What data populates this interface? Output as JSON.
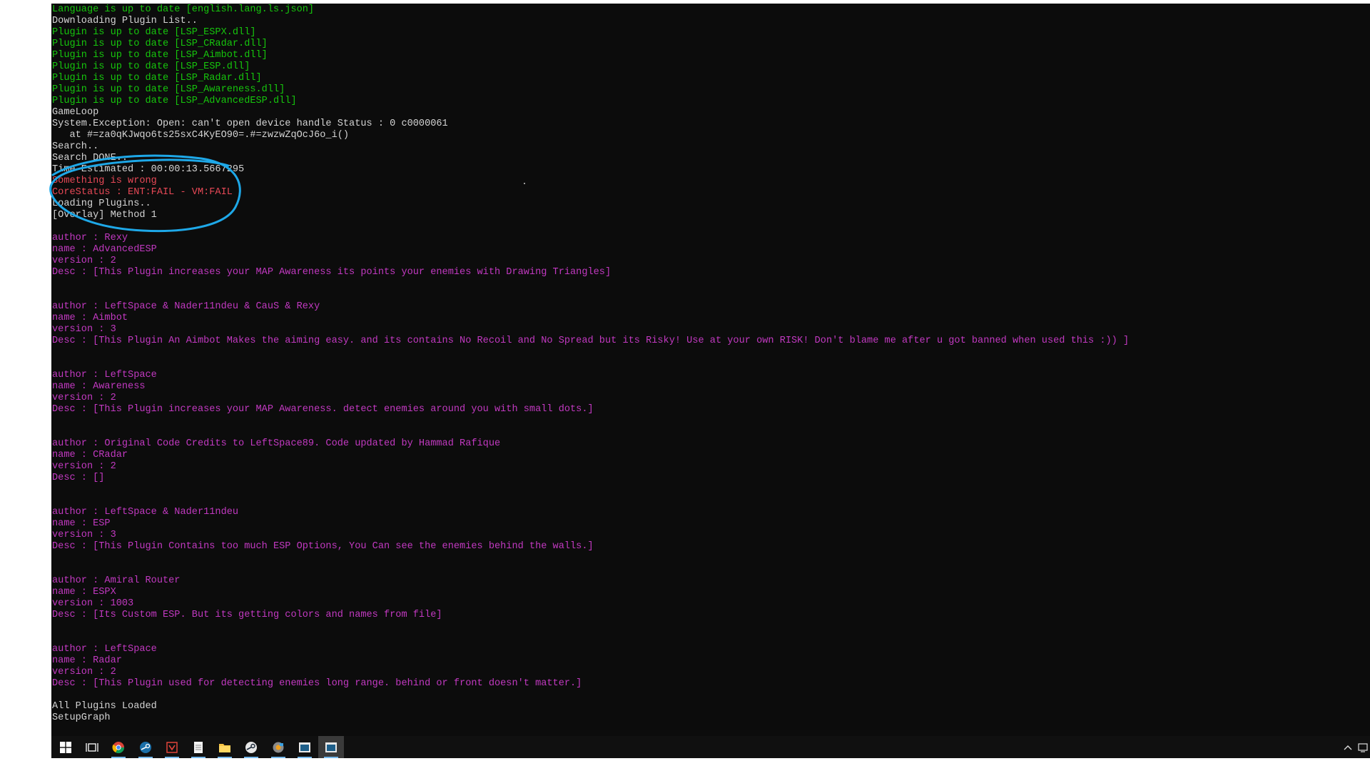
{
  "console": {
    "lines": [
      {
        "text": "Language is up to date [english.lang.ls.json]",
        "color": "green"
      },
      {
        "text": "Downloading Plugin List..",
        "color": "white"
      },
      {
        "text": "Plugin is up to date [LSP_ESPX.dll]",
        "color": "green"
      },
      {
        "text": "Plugin is up to date [LSP_CRadar.dll]",
        "color": "green"
      },
      {
        "text": "Plugin is up to date [LSP_Aimbot.dll]",
        "color": "green"
      },
      {
        "text": "Plugin is up to date [LSP_ESP.dll]",
        "color": "green"
      },
      {
        "text": "Plugin is up to date [LSP_Radar.dll]",
        "color": "green"
      },
      {
        "text": "Plugin is up to date [LSP_Awareness.dll]",
        "color": "green"
      },
      {
        "text": "Plugin is up to date [LSP_AdvancedESP.dll]",
        "color": "green"
      },
      {
        "text": "GameLoop",
        "color": "white"
      },
      {
        "text": "System.Exception: Open: can't open device handle Status : 0 c0000061",
        "color": "white"
      },
      {
        "text": "   at #=za0qKJwqo6ts25sxC4KyEO90=.#=zwzwZqOcJ6o_i()",
        "color": "white"
      },
      {
        "text": "Search..",
        "color": "white"
      },
      {
        "text": "Search DONE..",
        "color": "white"
      },
      {
        "text": "Time Estimated : 00:00:13.5667295",
        "color": "white"
      },
      {
        "text": "Something is wrong",
        "color": "red"
      },
      {
        "text": "CoreStatus : ENT:FAIL - VM:FAIL",
        "color": "red"
      },
      {
        "text": "Loading Plugins..",
        "color": "white"
      },
      {
        "text": "[Overlay] Method 1",
        "color": "white"
      },
      {
        "text": "",
        "color": "white"
      },
      {
        "text": "author : Rexy",
        "color": "purple"
      },
      {
        "text": "name : AdvancedESP",
        "color": "purple"
      },
      {
        "text": "version : 2",
        "color": "purple"
      },
      {
        "text": "Desc : [This Plugin increases your MAP Awareness its points your enemies with Drawing Triangles]",
        "color": "purple"
      },
      {
        "text": "",
        "color": "white"
      },
      {
        "text": "",
        "color": "white"
      },
      {
        "text": "author : LeftSpace & Nader11ndeu & CauS & Rexy",
        "color": "purple"
      },
      {
        "text": "name : Aimbot",
        "color": "purple"
      },
      {
        "text": "version : 3",
        "color": "purple"
      },
      {
        "text": "Desc : [This Plugin An Aimbot Makes the aiming easy. and its contains No Recoil and No Spread but its Risky! Use at your own RISK! Don't blame me after u got banned when used this :)) ]",
        "color": "purple"
      },
      {
        "text": "",
        "color": "white"
      },
      {
        "text": "",
        "color": "white"
      },
      {
        "text": "author : LeftSpace",
        "color": "purple"
      },
      {
        "text": "name : Awareness",
        "color": "purple"
      },
      {
        "text": "version : 2",
        "color": "purple"
      },
      {
        "text": "Desc : [This Plugin increases your MAP Awareness. detect enemies around you with small dots.]",
        "color": "purple"
      },
      {
        "text": "",
        "color": "white"
      },
      {
        "text": "",
        "color": "white"
      },
      {
        "text": "author : Original Code Credits to LeftSpace89. Code updated by Hammad Rafique",
        "color": "purple"
      },
      {
        "text": "name : CRadar",
        "color": "purple"
      },
      {
        "text": "version : 2",
        "color": "purple"
      },
      {
        "text": "Desc : []",
        "color": "purple"
      },
      {
        "text": "",
        "color": "white"
      },
      {
        "text": "",
        "color": "white"
      },
      {
        "text": "author : LeftSpace & Nader11ndeu",
        "color": "purple"
      },
      {
        "text": "name : ESP",
        "color": "purple"
      },
      {
        "text": "version : 3",
        "color": "purple"
      },
      {
        "text": "Desc : [This Plugin Contains too much ESP Options, You Can see the enemies behind the walls.]",
        "color": "purple"
      },
      {
        "text": "",
        "color": "white"
      },
      {
        "text": "",
        "color": "white"
      },
      {
        "text": "author : Amiral Router",
        "color": "purple"
      },
      {
        "text": "name : ESPX",
        "color": "purple"
      },
      {
        "text": "version : 1003",
        "color": "purple"
      },
      {
        "text": "Desc : [Its Custom ESP. But its getting colors and names from file]",
        "color": "purple"
      },
      {
        "text": "",
        "color": "white"
      },
      {
        "text": "",
        "color": "white"
      },
      {
        "text": "author : LeftSpace",
        "color": "purple"
      },
      {
        "text": "name : Radar",
        "color": "purple"
      },
      {
        "text": "version : 2",
        "color": "purple"
      },
      {
        "text": "Desc : [This Plugin used for detecting enemies long range. behind or front doesn't matter.]",
        "color": "purple"
      },
      {
        "text": "",
        "color": "white"
      },
      {
        "text": "All Plugins Loaded",
        "color": "white"
      },
      {
        "text": "SetupGraph",
        "color": "white"
      }
    ]
  },
  "colors": {
    "console_bg": "#0c0c0c",
    "white": "#d4d4d4",
    "green": "#16c60c",
    "red": "#e74856",
    "purple": "#c239c1",
    "annotation": "#1ea8e8",
    "taskbar_bg": "#101010",
    "taskbar_active": "#3a3a3a",
    "taskbar_underline": "#76b9ed"
  },
  "taskbar": {
    "items": [
      {
        "icon": "windows-start-icon",
        "active": false,
        "running": false
      },
      {
        "icon": "task-view-icon",
        "active": false,
        "running": false
      },
      {
        "icon": "chrome-icon",
        "active": false,
        "running": true
      },
      {
        "icon": "steam-icon",
        "active": false,
        "running": true
      },
      {
        "icon": "red-app-icon",
        "active": false,
        "running": true
      },
      {
        "icon": "notepad-icon",
        "active": false,
        "running": true
      },
      {
        "icon": "file-explorer-icon",
        "active": false,
        "running": true
      },
      {
        "icon": "steam-circle-icon",
        "active": false,
        "running": true
      },
      {
        "icon": "game-app-icon",
        "active": false,
        "running": true
      },
      {
        "icon": "console-window-icon",
        "active": false,
        "running": true
      },
      {
        "icon": "console-window-active-icon",
        "active": true,
        "running": true
      }
    ],
    "tray": [
      "chevron-up-icon",
      "network-icon"
    ]
  }
}
